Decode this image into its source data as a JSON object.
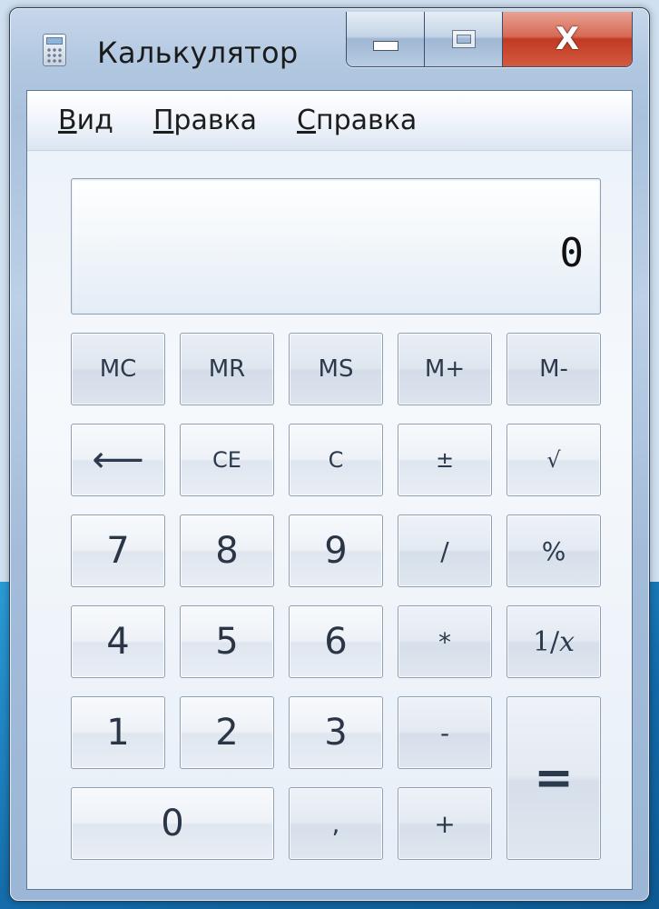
{
  "window": {
    "title": "Калькулятор",
    "close_label": "X"
  },
  "menu": {
    "items": [
      {
        "underlined": "В",
        "rest": "ид"
      },
      {
        "underlined": "П",
        "rest": "равка"
      },
      {
        "underlined": "С",
        "rest": "правка"
      }
    ]
  },
  "display": {
    "value": "0"
  },
  "keys": {
    "mc": "MC",
    "mr": "MR",
    "ms": "MS",
    "mplus": "M+",
    "mminus": "M-",
    "backspace": "⟵",
    "ce": "CE",
    "c": "C",
    "plusminus": "±",
    "sqrt": "√",
    "d7": "7",
    "d8": "8",
    "d9": "9",
    "divide": "/",
    "percent": "%",
    "d4": "4",
    "d5": "5",
    "d6": "6",
    "multiply": "*",
    "recip_prefix": "1/",
    "recip_var": "x",
    "d1": "1",
    "d2": "2",
    "d3": "3",
    "minus": "-",
    "equals": "=",
    "d0": "0",
    "comma": ",",
    "plus": "+"
  }
}
